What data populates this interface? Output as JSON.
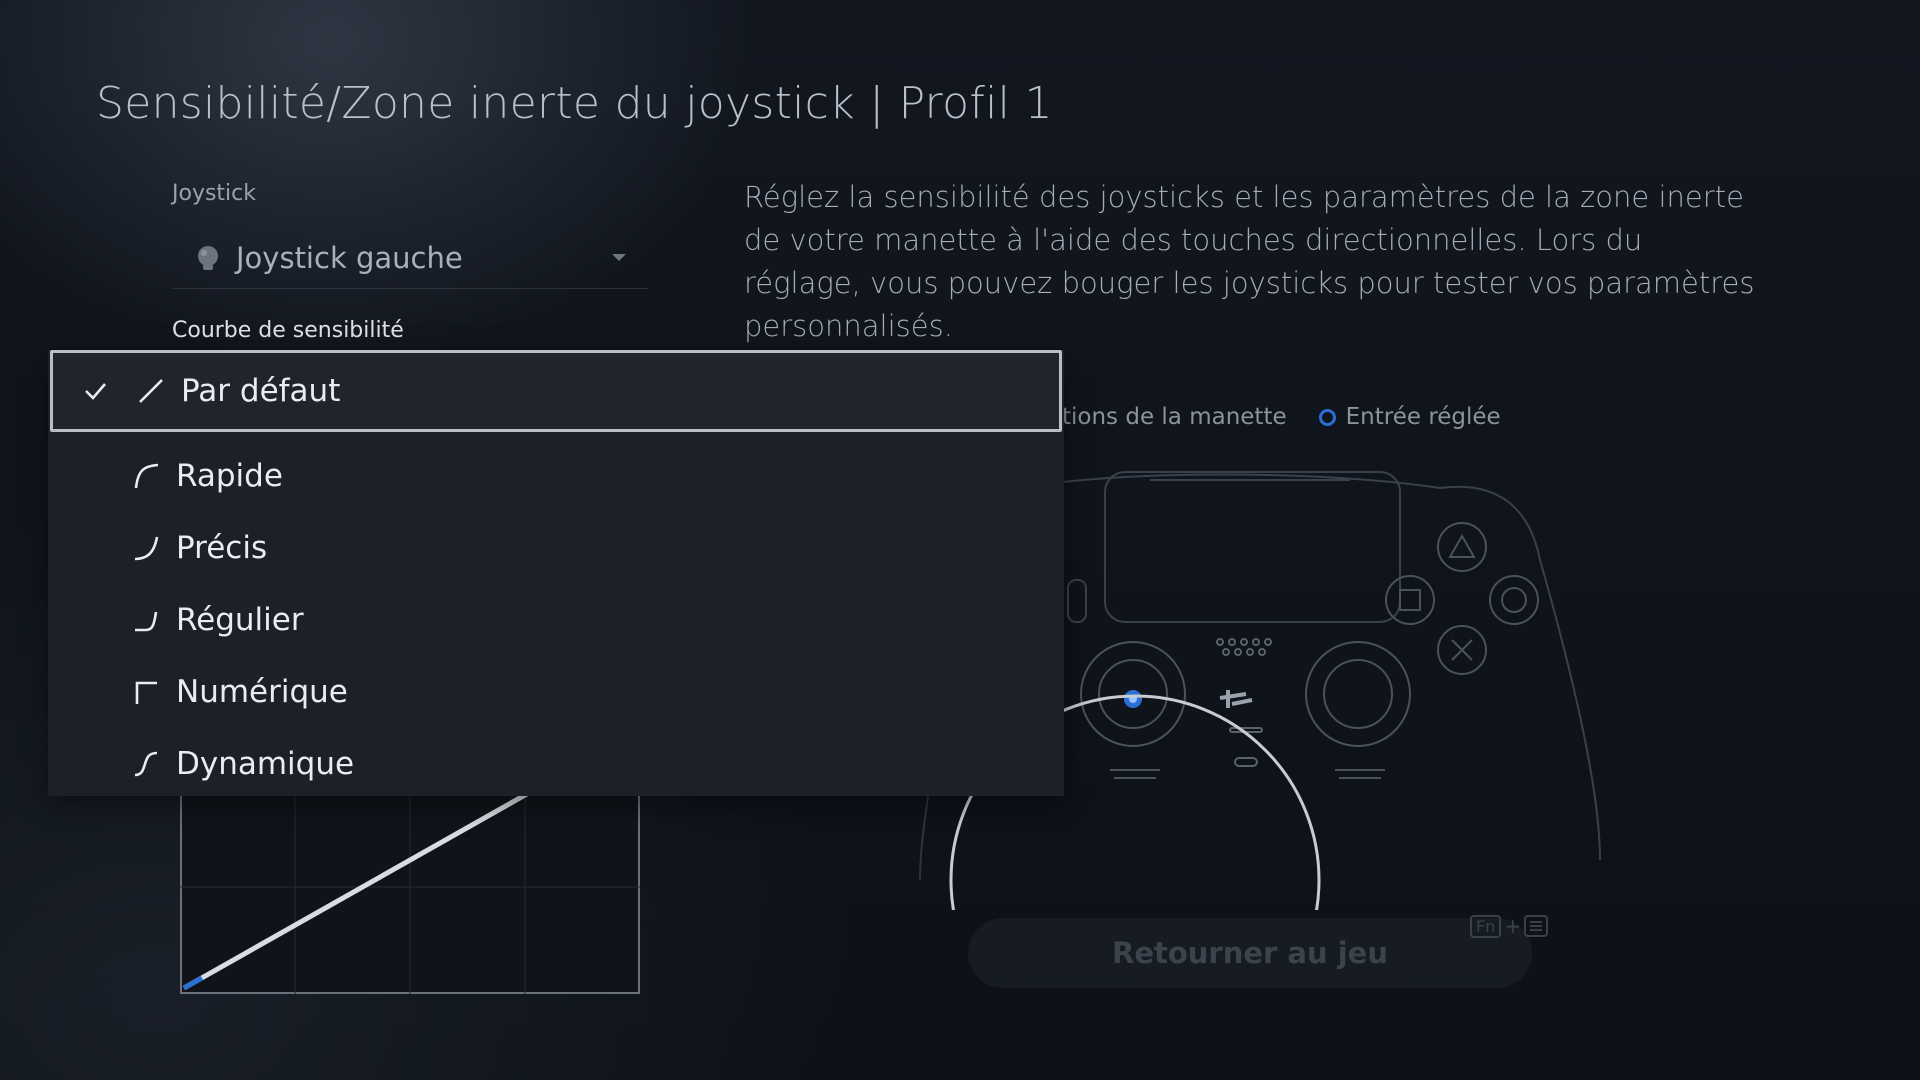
{
  "page": {
    "title": "Sensibilité/Zone inerte du joystick | Profil 1"
  },
  "joystick": {
    "label": "Joystick",
    "selected": "Joystick gauche"
  },
  "curve": {
    "label": "Courbe de sensibilité",
    "options": [
      {
        "label": "Par défaut",
        "icon": "linear-curve-icon",
        "selected": true
      },
      {
        "label": "Rapide",
        "icon": "quick-curve-icon",
        "selected": false
      },
      {
        "label": "Précis",
        "icon": "precise-curve-icon",
        "selected": false
      },
      {
        "label": "Régulier",
        "icon": "steady-curve-icon",
        "selected": false
      },
      {
        "label": "Numérique",
        "icon": "digital-curve-icon",
        "selected": false
      },
      {
        "label": "Dynamique",
        "icon": "dynamic-curve-icon",
        "selected": false
      }
    ]
  },
  "description": "Réglez la sensibilité des joysticks et les paramètres de la zone inerte de votre manette à l'aide des touches directionnelles. Lors du réglage, vous pouvez bouger les joysticks pour tester vos paramètres personnalisés.",
  "legend": {
    "controller_actions_partial": "tions de la manette",
    "adjusted_input": "Entrée réglée"
  },
  "return_button": "Retourner au jeu",
  "shortcut": {
    "key1": "Fn",
    "plus": "+"
  },
  "colors": {
    "accent": "#2b6fd6",
    "background": "#0e1218",
    "dropdown": "#1c2027"
  }
}
